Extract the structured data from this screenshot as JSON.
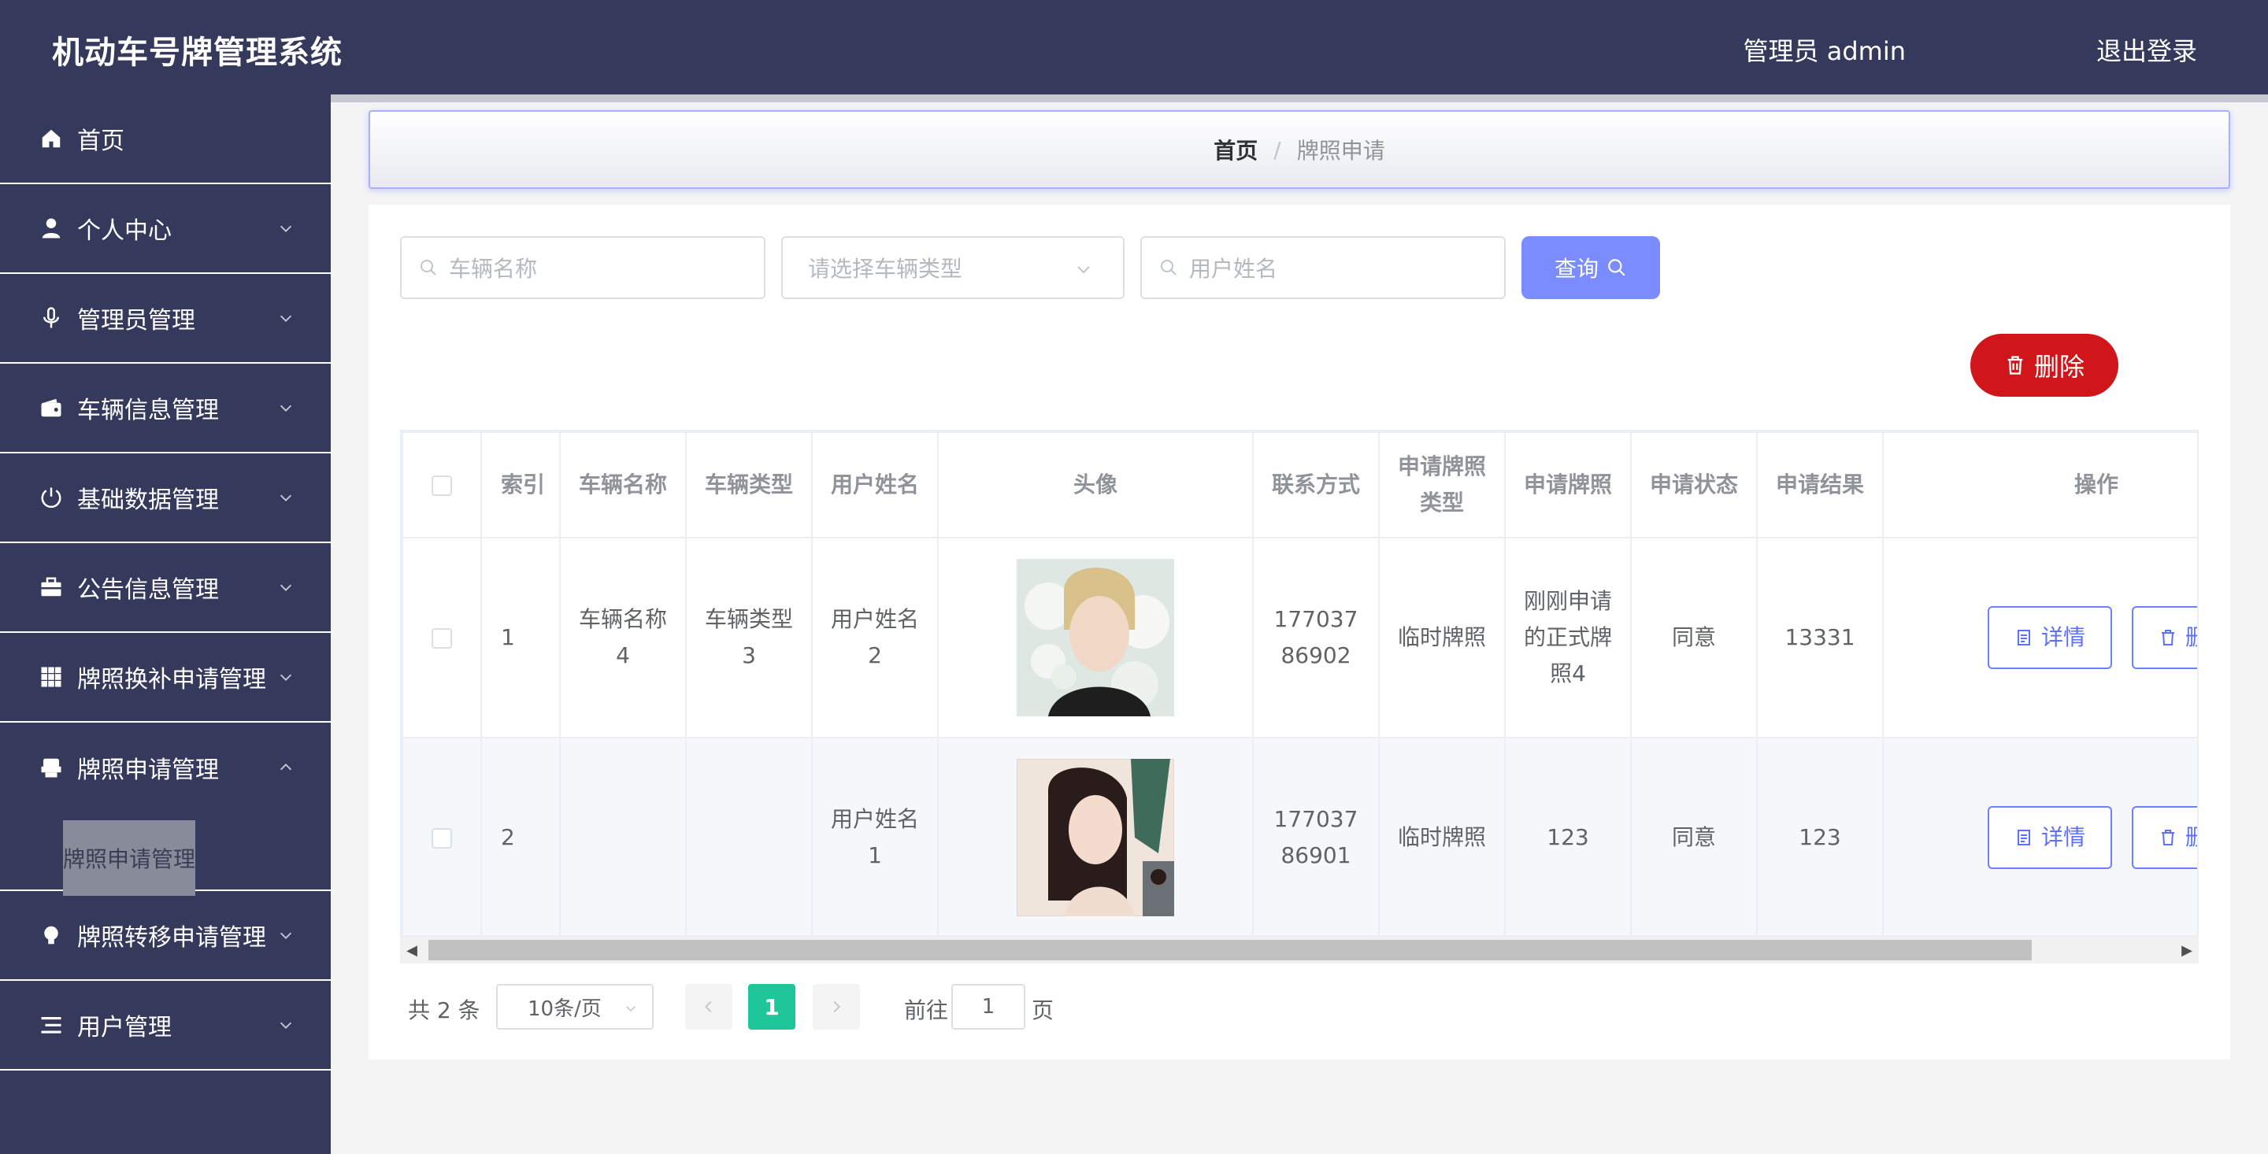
{
  "header": {
    "title": "机动车号牌管理系统",
    "user": "管理员 admin",
    "logout": "退出登录"
  },
  "sidebar": {
    "items": [
      {
        "label": "首页",
        "icon": "home-icon"
      },
      {
        "label": "个人中心",
        "icon": "user-icon"
      },
      {
        "label": "管理员管理",
        "icon": "microphone-icon"
      },
      {
        "label": "车辆信息管理",
        "icon": "wallet-icon"
      },
      {
        "label": "基础数据管理",
        "icon": "power-icon"
      },
      {
        "label": "公告信息管理",
        "icon": "briefcase-icon"
      },
      {
        "label": "牌照换补申请管理",
        "icon": "grid-icon"
      },
      {
        "label": "牌照申请管理",
        "icon": "printer-icon",
        "expanded": true
      },
      {
        "label": "牌照转移申请管理",
        "icon": "bulb-icon"
      },
      {
        "label": "用户管理",
        "icon": "list-icon"
      }
    ],
    "active_sub": "牌照申请管理"
  },
  "breadcrumb": {
    "home": "首页",
    "separator": "/",
    "current": "牌照申请"
  },
  "search": {
    "vehicle_name_placeholder": "车辆名称",
    "vehicle_type_placeholder": "请选择车辆类型",
    "user_name_placeholder": "用户姓名",
    "query_label": "查询",
    "delete_label": "删除"
  },
  "table": {
    "headers": [
      "索引",
      "车辆名称",
      "车辆类型",
      "用户姓名",
      "头像",
      "联系方式",
      "申请牌照类型",
      "申请牌照",
      "申请状态",
      "申请结果",
      "操作"
    ],
    "rows": [
      {
        "index": "1",
        "vehicle_name": "车辆名称4",
        "vehicle_type": "车辆类型3",
        "user_name": "用户姓名2",
        "contact": "17703786902",
        "plate_type": "临时牌照",
        "plate": "刚刚申请的正式牌照4",
        "status": "同意",
        "result": "13331"
      },
      {
        "index": "2",
        "vehicle_name": "",
        "vehicle_type": "",
        "user_name": "用户姓名1",
        "contact": "17703786901",
        "plate_type": "临时牌照",
        "plate": "123",
        "status": "同意",
        "result": "123"
      }
    ],
    "detail_label": "详情",
    "delete_label": "删除"
  },
  "pagination": {
    "total": "共 2 条",
    "page_size": "10条/页",
    "current_page": "1",
    "goto": "前往",
    "goto_value": "1",
    "page_unit": "页"
  },
  "colors": {
    "header_bg": "#353a5c",
    "primary": "#7a8cff",
    "danger": "#d0161b",
    "active_page": "#1fc69a"
  }
}
